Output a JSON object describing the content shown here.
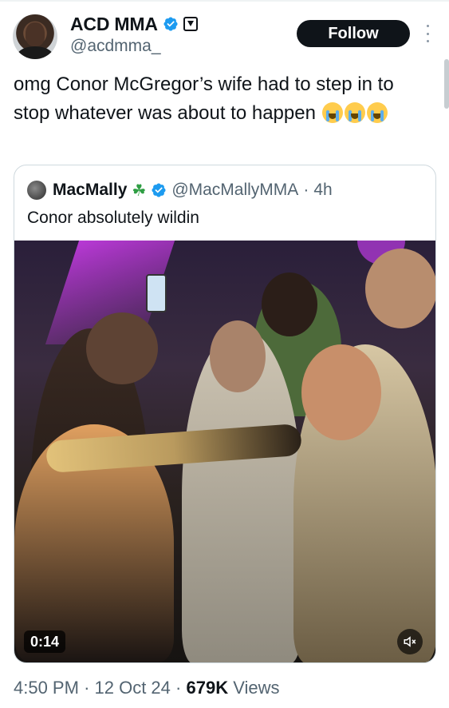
{
  "author": {
    "display_name": "ACD MMA",
    "handle": "@acdmma_",
    "follow_label": "Follow"
  },
  "tweet": {
    "text": "omg Conor McGregor’s wife had to step in to stop whatever was about to happen",
    "emojis": [
      "loudly-crying-face-icon",
      "loudly-crying-face-icon",
      "loudly-crying-face-icon"
    ]
  },
  "quote": {
    "display_name": "MacMally",
    "name_emoji": "☘",
    "handle": "@MacMallyMMA",
    "separator": "·",
    "age": "4h",
    "text": "Conor absolutely wildin",
    "video": {
      "duration": "0:14",
      "muted": true
    }
  },
  "footer": {
    "time": "4:50 PM",
    "separator_1": "·",
    "date": "12 Oct 24",
    "separator_2": "·",
    "views_count": "679K",
    "views_label": "Views"
  },
  "colors": {
    "verified": "#1d9bf0",
    "text_primary": "#0f1419",
    "text_secondary": "#536471",
    "border": "#cfd9de"
  }
}
